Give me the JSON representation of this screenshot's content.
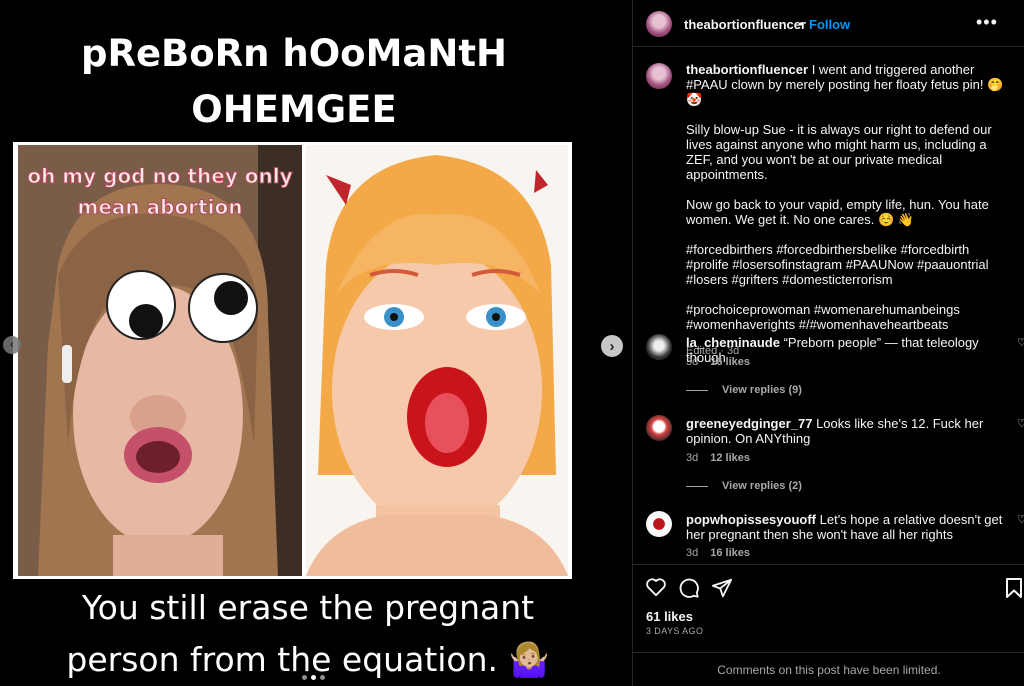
{
  "media": {
    "meme_top_line1": "pReBoRn hOoMaNtH",
    "meme_top_line2": "OHEMGEE",
    "caption_line1": "oh my god no they only",
    "caption_line2": "mean abortion",
    "meme_bottom_line1": "You still erase the pregnant",
    "meme_bottom_line2": "person from the equation. 🤷🏼‍♀️",
    "prev_icon": "chevron-left-icon",
    "next_icon": "chevron-right-icon",
    "carousel_pages": 3,
    "carousel_active_page": 2
  },
  "header": {
    "username": "theabortionfluencer",
    "separator": "•",
    "follow_label": "Follow",
    "more_label": "•••"
  },
  "post": {
    "username": "theabortionfluencer",
    "text_intro": "I went and triggered another #PAAU clown by merely posting her floaty fetus pin! 🤭 🤡",
    "paragraph2": "Silly blow-up Sue - it is always our right to defend our lives against anyone who might harm us, including a ZEF, and you won't be at our private medical appointments.",
    "paragraph3": "Now go back to your vapid, empty life, hun. You hate women. We get it. No one cares. ☺️ 👋",
    "paragraph4": "#forcedbirthers #forcedbirthersbelike #forcedbirth #prolife #losersofinstagram #PAAUNow #paauontrial #losers #grifters #domesticterrorism",
    "paragraph5": "#prochoiceprowoman #womenarehumanbeings #womenhaverights #/#womenhaveheartbeats",
    "edited": "Edited · 3d"
  },
  "comments": [
    {
      "username": "la_cheminaude",
      "text": "“Preborn people” — that teleology though",
      "age": "3d",
      "likes": "16 likes",
      "replies": "View replies (9)"
    },
    {
      "username": "greeneyedginger_77",
      "text": "Looks like she's 12. Fuck her opinion. On ANYthing",
      "age": "3d",
      "likes": "12 likes",
      "replies": "View replies (2)"
    },
    {
      "username": "popwhopissesyouoff",
      "text": "Let's hope a relative doesn't get her pregnant then she won't have all her rights",
      "age": "3d",
      "likes": "16 likes"
    }
  ],
  "actions": {
    "likes": "61 likes",
    "posted_ago": "3 DAYS AGO",
    "limited_notice": "Comments on this post have been limited."
  },
  "colors": {
    "background": "#000000",
    "text": "#f5f5f5",
    "muted": "#a8a8a8",
    "link": "#0095f6",
    "border": "#262626"
  }
}
